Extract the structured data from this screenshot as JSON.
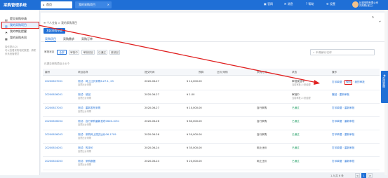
{
  "header": {
    "brand": "采购管理系统",
    "home_tab": "首页",
    "current_tab": "我的采购项目",
    "menu": [
      "官网",
      "消息",
      "帮助",
      "设置"
    ],
    "user_name": "比德采购有限公司",
    "user_role": "刘采购(张三)"
  },
  "sidebar": {
    "items": [
      {
        "label": "提交采购申请",
        "icon": "doc-icon"
      },
      {
        "label": "我的采购项目",
        "icon": "folder-icon"
      },
      {
        "label": "我的审批提醒",
        "icon": "bell-icon"
      },
      {
        "label": "我的采购合同",
        "icon": "file-icon"
      }
    ],
    "note_title": "操作提示(2)",
    "note_text": "可以查看采购相关数据，请联系系统管理员"
  },
  "main": {
    "breadcrumb": "个人业务 > 我的采购项目",
    "new_button": "发起采购申请",
    "tabs": [
      "采购项目",
      "采购需求",
      "采购订单"
    ],
    "filters": [
      "审批状态",
      "全部",
      "审批中",
      "审批驳回",
      "已通过",
      "被驳回"
    ],
    "search_placeholder": "申请编号/名称",
    "info": "已提交采购项目(14)个",
    "table": {
      "headers": [
        "编号",
        "项目名称",
        "提交时间",
        "预算",
        "比价/采购",
        "采购方式",
        "状态",
        "操作"
      ],
      "rows": [
        {
          "id": "20200627001",
          "name": "测试：网上比价采购6.27-1, 23",
          "sub": "自然比价采购",
          "date": "2020-06-27",
          "budget": "¥ 12,000.00",
          "compare": "",
          "method": "",
          "status": "审批驳回中",
          "status_sub": "当前审批人:张经理",
          "ops": [
            "打印单据",
            "驳回",
            "我的审批"
          ]
        },
        {
          "id": "20200626001",
          "name": "测试：驳回",
          "sub": "自然比价采购",
          "date": "2020-06-27",
          "budget": "¥ 1.00",
          "compare": "",
          "method": "",
          "status": "审批中",
          "status_sub": "当前审批人:张经理",
          "ops": [
            "撤回",
            "重新审批"
          ]
        },
        {
          "id": "20200627003",
          "name": "测试：重新发布采购",
          "sub": "自然比价采购",
          "date": "2020-06-27",
          "budget": "¥ 10,000.00",
          "compare": "",
          "method": "自行采购",
          "status": "已通过",
          "status_sub": "",
          "ops": [
            "打印单据",
            "重新审批"
          ]
        },
        {
          "id": "20200626004",
          "name": "测试：自行采购重新发布0626-1051",
          "sub": "自然比价采购",
          "date": "2020-06-26",
          "budget": "¥ 80,000.00",
          "compare": "",
          "method": "自行采购",
          "status": "已通过",
          "status_sub": "",
          "ops": [
            "打印单据",
            "重新审批"
          ]
        },
        {
          "id": "20200626003",
          "name": "测试：采购网上提交比价06-1709",
          "sub": "自然比价采购",
          "date": "2020-06-26",
          "budget": "¥ 50,000.00",
          "compare": "",
          "method": "自行采购",
          "status": "已通过",
          "status_sub": "",
          "ops": [
            "打印单据",
            "重新审批"
          ]
        },
        {
          "id": "20200624001",
          "name": "测试：的评价",
          "sub": "自然比价采购",
          "date": "2020-06-24",
          "budget": "¥ 35,000.00",
          "compare": "",
          "method": "网上比价",
          "status": "已通过",
          "status_sub": "",
          "ops": [
            "打印单据",
            "重新审批"
          ]
        },
        {
          "id": "20200624003",
          "name": "测试：采购数据",
          "sub": "自然比价采购",
          "date": "2020-06-24",
          "budget": "¥ 20,000.00",
          "compare": "",
          "method": "网上比价",
          "status": "已通过",
          "status_sub": "",
          "ops": [
            "打印单据",
            "重新审批"
          ]
        }
      ]
    },
    "pager_text": "1-5/共 6 条",
    "pages": [
      "<",
      "1",
      ">"
    ]
  },
  "float_button": "在线客服",
  "colors": {
    "primary": "#1f6fd6",
    "highlight": "#e02020",
    "success": "#2aa26b"
  }
}
